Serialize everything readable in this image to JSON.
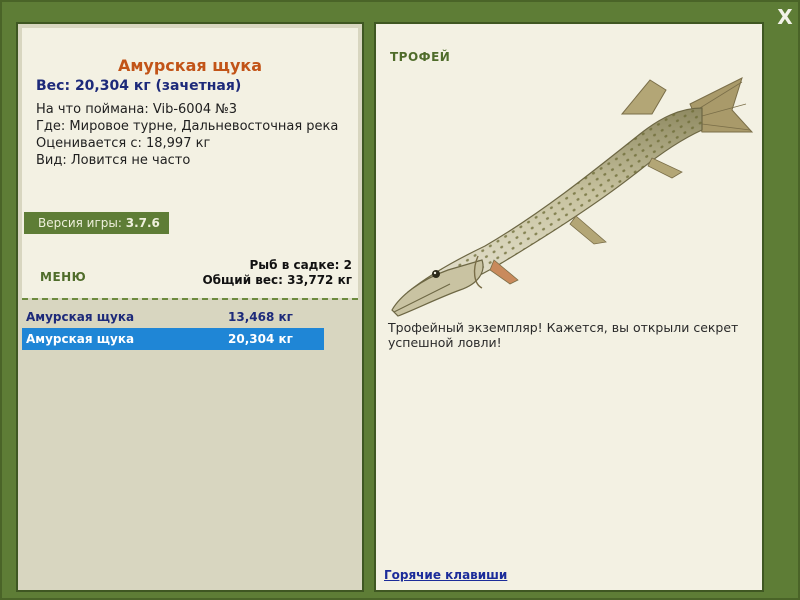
{
  "window": {
    "close_label": "X"
  },
  "fish_info": {
    "title": "Амурская щука",
    "weight_line": "Вес: 20,304 кг (зачетная)",
    "lines": [
      "На что поймана: Vib-6004 №3",
      "Где: Мировое турне, Дальневосточная река",
      "Оценивается с: 18,997 кг",
      "Вид: Ловится не часто"
    ]
  },
  "version": {
    "label": "Версия игры: ",
    "value": "3.7.6"
  },
  "menu": {
    "label": "МЕНЮ"
  },
  "keepnet": {
    "fish_count": "Рыб в садке: 2",
    "total_weight": "Общий вес: 33,772 кг"
  },
  "catch_list": [
    {
      "name": "Амурская щука",
      "weight": "13,468 кг",
      "selected": false
    },
    {
      "name": "Амурская щука",
      "weight": "20,304 кг",
      "selected": true
    }
  ],
  "trophy": {
    "label": "ТРОФЕЙ",
    "description": "Трофейный экземпляр! Кажется, вы открыли секрет успешной ловли!"
  },
  "footer": {
    "hotkeys_link": "Горячие клавиши"
  },
  "colors": {
    "frame_green": "#5e7d36",
    "panel_bg": "#f3f1e3",
    "title_orange": "#c25418",
    "text_navy": "#1d2a7a",
    "selection_blue": "#1f86d6"
  }
}
